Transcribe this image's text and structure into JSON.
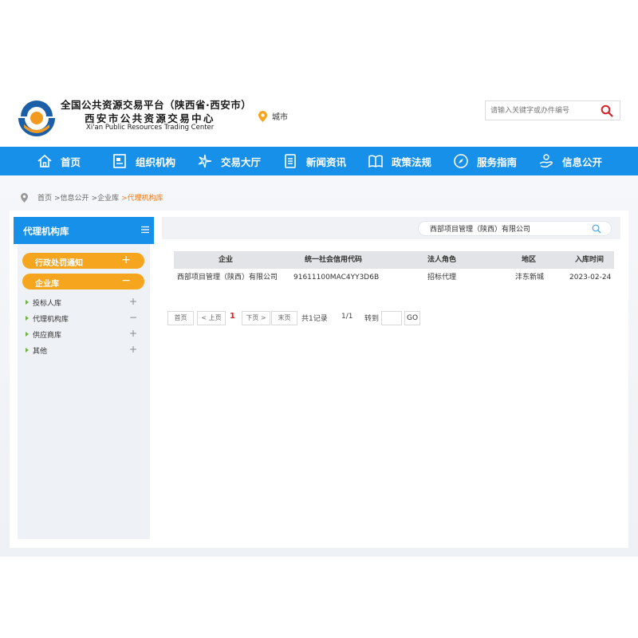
{
  "header": {
    "title": "全国公共资源交易平台（陕西省·西安市）",
    "subtitle": "西安市公共资源交易中心",
    "english": "Xi'an Public Resources Trading Center",
    "city_label": "城市",
    "search_placeholder": "请输入关键字或办件编号"
  },
  "nav": {
    "items": [
      {
        "label": "首页",
        "icon": "home-icon"
      },
      {
        "label": "组织机构",
        "icon": "org-icon"
      },
      {
        "label": "交易大厅",
        "icon": "star-icon"
      },
      {
        "label": "新闻资讯",
        "icon": "news-icon"
      },
      {
        "label": "政策法规",
        "icon": "book-icon"
      },
      {
        "label": "服务指南",
        "icon": "compass-icon"
      },
      {
        "label": "信息公开",
        "icon": "hand-icon"
      }
    ]
  },
  "breadcrumb": {
    "home": "首页",
    "level1": ">信息公开",
    "level2": ">企业库",
    "current": ">代理机构库"
  },
  "sidebar": {
    "title": "代理机构库",
    "groups": [
      {
        "label": "行政处罚通知",
        "sign": "+"
      },
      {
        "label": "企业库",
        "sign": "−"
      }
    ],
    "items": [
      {
        "label": "投标人库",
        "sign": "+"
      },
      {
        "label": "代理机构库",
        "sign": "−"
      },
      {
        "label": "供应商库",
        "sign": "+"
      },
      {
        "label": "其他",
        "sign": "+"
      }
    ]
  },
  "filter": {
    "value": "西部项目管理（陕西）有限公司"
  },
  "table": {
    "headers": [
      "企业",
      "统一社会信用代码",
      "法人角色",
      "地区",
      "入库时间"
    ],
    "rows": [
      [
        "西部项目管理（陕西）有限公司",
        "91611100MAC4YY3D6B",
        "招标代理",
        "沣东新城",
        "2023-02-24"
      ]
    ]
  },
  "pager": {
    "first": "首页",
    "prev": "< 上页",
    "current": "1",
    "next": "下页 >",
    "last": "末页",
    "total": "共1记录",
    "pages": "1/1",
    "goto": "转到",
    "go": "GO"
  },
  "colors": {
    "nav_blue": "#1790ea",
    "pill_orange": "#f6a51f",
    "breadcrumb_current": "#f07a1a",
    "pager_current": "#e02020"
  }
}
